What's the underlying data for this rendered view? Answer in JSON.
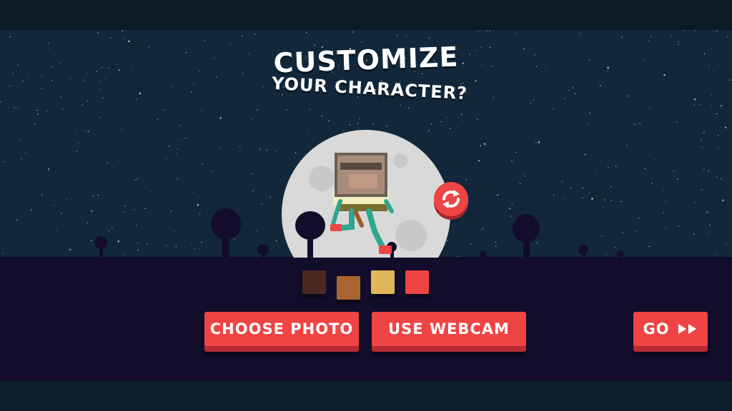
{
  "title": {
    "line1": "CUSTOMIZE",
    "line2": "YOUR CHARACTER?"
  },
  "buttons": {
    "choose_photo": "CHOOSE PHOTO",
    "use_webcam": "USE WEBCAM",
    "go": "GO"
  },
  "swatches": [
    {
      "name": "dark-brown",
      "color": "#4a2a1f"
    },
    {
      "name": "brown",
      "color": "#a9652f"
    },
    {
      "name": "tan",
      "color": "#e2b65b"
    },
    {
      "name": "red",
      "color": "#ef4444"
    }
  ],
  "colors": {
    "accent": "#ef4444",
    "sky": "#12273a",
    "ground": "#120d2a",
    "moon": "#d9d9d9"
  },
  "icons": {
    "refresh": "refresh-icon",
    "go_arrows": "fast-forward-icon"
  }
}
